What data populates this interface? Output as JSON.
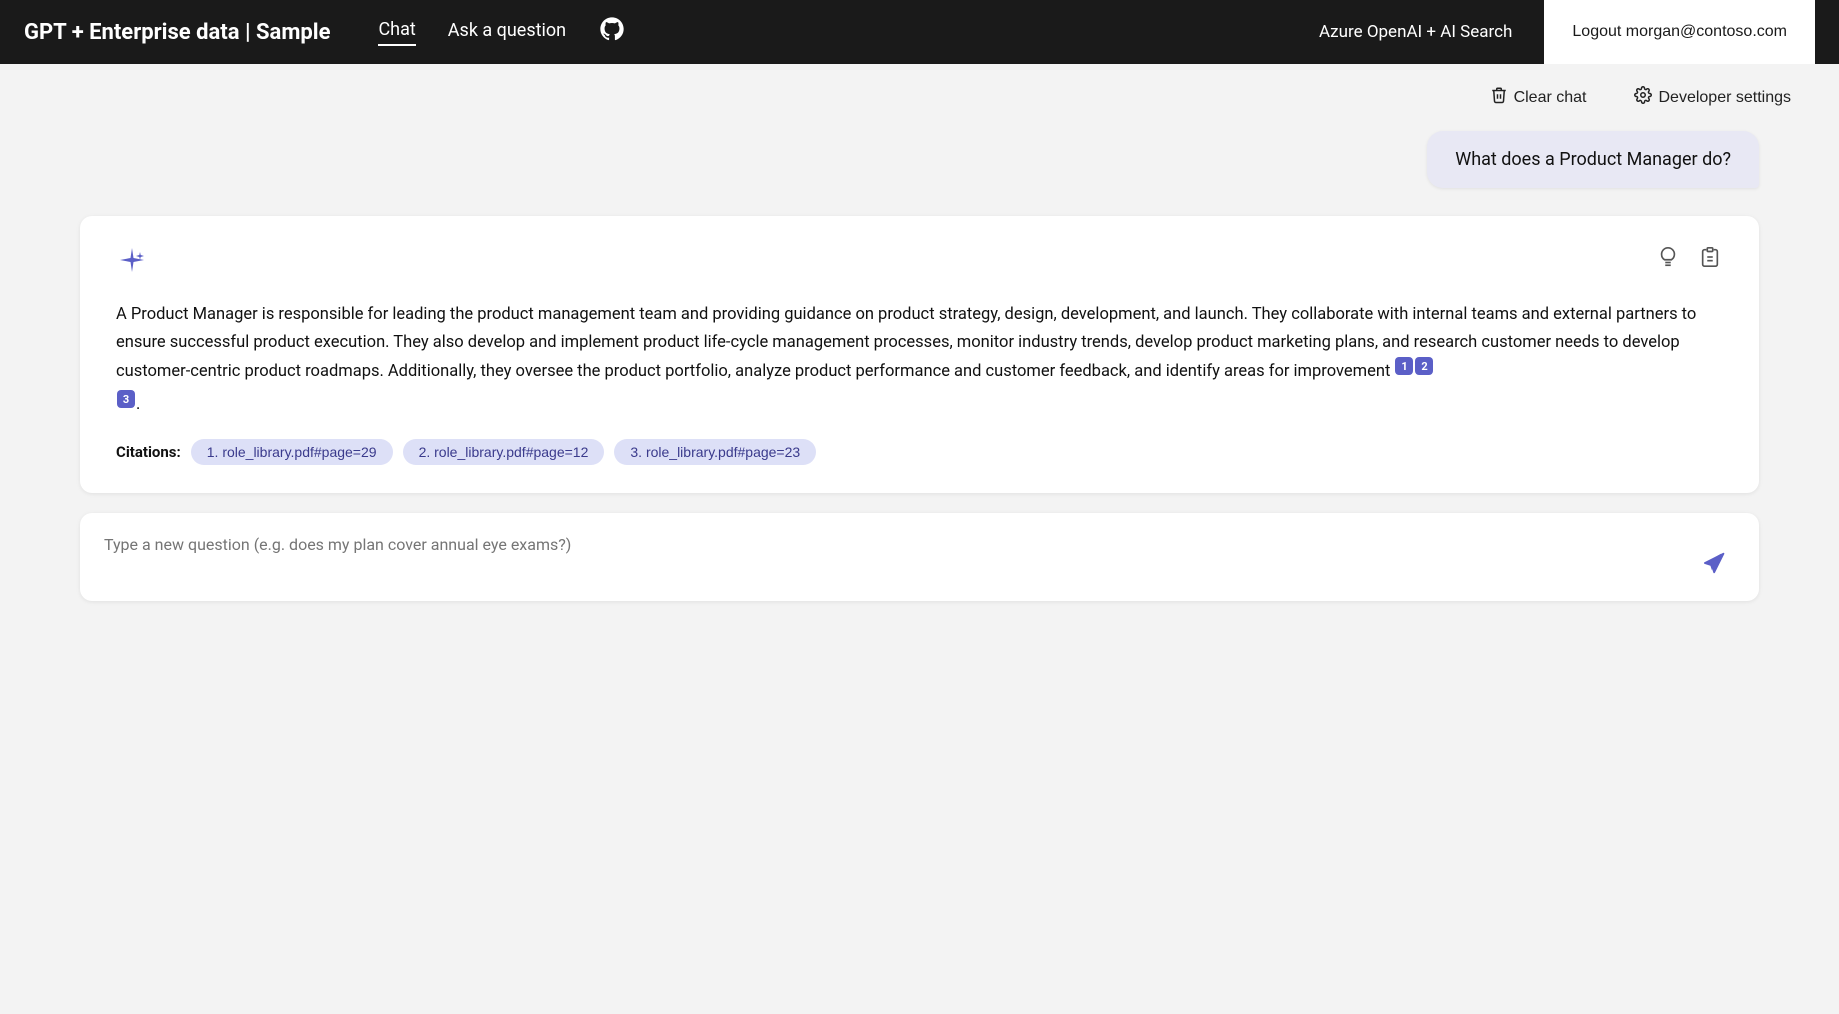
{
  "nav": {
    "brand": "GPT + Enterprise data | Sample",
    "links": [
      {
        "label": "Chat",
        "active": true
      },
      {
        "label": "Ask a question",
        "active": false
      }
    ],
    "github_icon": "github",
    "service": "Azure OpenAI + AI Search",
    "logout_label": "Logout morgan@contoso.com"
  },
  "toolbar": {
    "clear_chat_label": "Clear chat",
    "developer_settings_label": "Developer settings"
  },
  "chat": {
    "user_message": "What does a Product Manager do?",
    "ai_response": "A Product Manager is responsible for leading the product management team and providing guidance on product strategy, design, development, and launch. They collaborate with internal teams and external partners to ensure successful product execution. They also develop and implement product life-cycle management processes, monitor industry trends, develop product marketing plans, and research customer needs to develop customer-centric product roadmaps. Additionally, they oversee the product portfolio, analyze product performance and customer feedback, and identify areas for improvement",
    "citations_label": "Citations:",
    "citations": [
      {
        "label": "1. role_library.pdf#page=29",
        "num": "1"
      },
      {
        "label": "2. role_library.pdf#page=12",
        "num": "2"
      },
      {
        "label": "3. role_library.pdf#page=23",
        "num": "3"
      }
    ],
    "sup_refs": [
      "1",
      "2",
      "3"
    ],
    "input_placeholder": "Type a new question (e.g. does my plan cover annual eye exams?)"
  }
}
